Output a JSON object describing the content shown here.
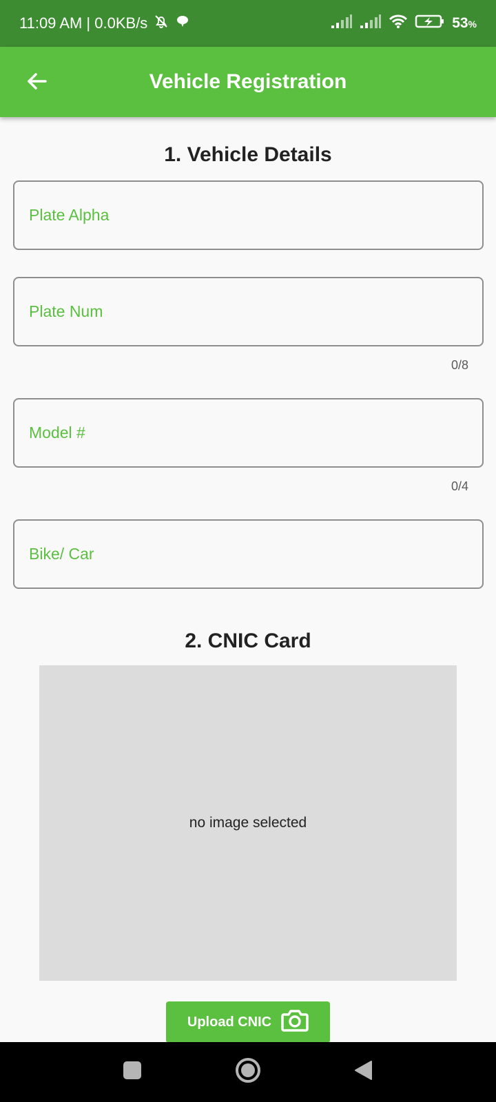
{
  "status_bar": {
    "time_text": "11:09 AM | 0.0KB/s",
    "battery": "53",
    "battery_unit": "%",
    "icons": [
      "bell-off-icon",
      "chat-bubble-icon",
      "signal-icon",
      "signal-icon",
      "wifi-icon",
      "battery-charging-icon"
    ]
  },
  "app_bar": {
    "title": "Vehicle Registration",
    "back_icon": "arrow-left-icon"
  },
  "vehicle_section": {
    "title": "1. Vehicle Details",
    "fields": {
      "plate_alpha": {
        "placeholder": "Plate Alpha",
        "value": ""
      },
      "plate_num": {
        "placeholder": "Plate Num",
        "value": "",
        "counter": "0/8"
      },
      "model": {
        "placeholder": "Model #",
        "value": "",
        "counter": "0/4"
      },
      "vehicle_type": {
        "placeholder": "Bike/ Car",
        "value": ""
      }
    }
  },
  "cnic_section": {
    "title": "2. CNIC Card",
    "placeholder_text": "no image selected",
    "upload_label": "Upload CNIC",
    "upload_icon": "camera-icon"
  },
  "nav_bar": {
    "icons": [
      "square-recent-icon",
      "circle-home-icon",
      "triangle-back-icon"
    ]
  },
  "colors": {
    "status_bar": "#3e8c31",
    "app_bar": "#5bbf40",
    "accent": "#5bbf40",
    "field_border": "#8e8e8e",
    "image_placeholder": "#dcdcdc",
    "background": "#f9f9f9"
  }
}
